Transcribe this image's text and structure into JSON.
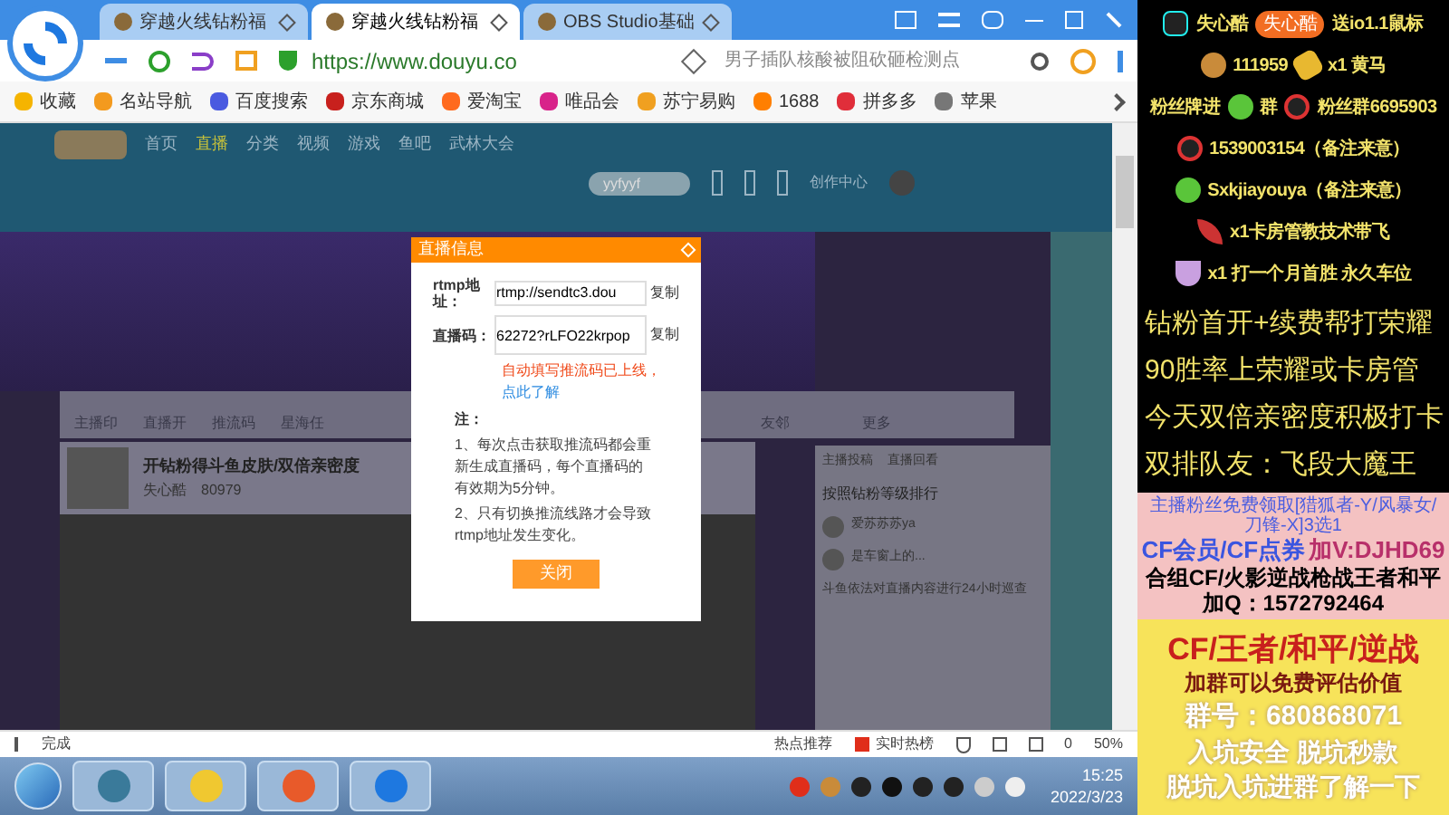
{
  "browser": {
    "tabs": [
      {
        "title": "穿越火线钻粉福",
        "selected": false
      },
      {
        "title": "穿越火线钻粉福",
        "selected": true
      },
      {
        "title": "OBS Studio基础",
        "selected": false
      }
    ],
    "url": "https://www.douyu.co",
    "search": {
      "placeholder": "男子插队核酸被阻砍砸检测点"
    },
    "bookmarks": [
      "收藏",
      "名站导航",
      "百度搜索",
      "京东商城",
      "爱淘宝",
      "唯品会",
      "苏宁易购",
      "1688",
      "拼多多",
      "苹果"
    ]
  },
  "page": {
    "nav": [
      {
        "label": "首页",
        "selected": false
      },
      {
        "label": "直播",
        "selected": true
      },
      {
        "label": "分类",
        "selected": false
      },
      {
        "label": "视频",
        "selected": false
      },
      {
        "label": "游戏",
        "selected": false
      },
      {
        "label": "鱼吧",
        "selected": false
      },
      {
        "label": "武林大会",
        "selected": false
      }
    ],
    "search": {
      "value": "yyfyyf"
    },
    "creator_link": "创作中心",
    "room_tools": [
      "主播印",
      "直播开",
      "推流码",
      "星海任",
      "友邻",
      "更多"
    ],
    "room": {
      "title": "开钻粉得斗鱼皮肤/双倍亲密度",
      "streamer": "失心酷",
      "hot": "80979"
    },
    "side": {
      "tabs": [
        "主播投稿",
        "直播回看"
      ],
      "rank_title": "按照钻粉等级排行",
      "fans": [
        "爱苏苏苏ya",
        "是车窗上的..."
      ],
      "notice": "斗鱼依法对直播内容进行24小时巡查"
    }
  },
  "dialog": {
    "title": "直播信息",
    "address_label": "rtmp地址：",
    "address": "rtmp://sendtc3.dou",
    "code_label": "直播码：",
    "code": "62272?rLFO22krpop",
    "copy": [
      "复制",
      "复制"
    ],
    "notice": "自动填写推流码已上线，",
    "link": "点此了解",
    "note_title": "注：",
    "notes": [
      "1、每次点击获取推流码都会重新生成直播码，每个直播码的有效期为5分钟。",
      "2、只有切换推流线路才会导致rtmp地址发生变化。"
    ],
    "close": "关闭"
  },
  "status_bar": {
    "text": "完成",
    "hot": "热点推荐",
    "rank": "实时热榜",
    "count": "0",
    "zoom": "50%"
  },
  "taskbar": {
    "time": "15:25",
    "date": "2022/3/23"
  },
  "overlay": {
    "rows": [
      {
        "parts": [
          {
            "kind": "icon"
          },
          {
            "kind": "text",
            "text": "失心酷"
          },
          {
            "kind": "badge",
            "text": "失心酷"
          },
          {
            "kind": "text",
            "text": "送io1.1鼠标"
          }
        ]
      },
      {
        "parts": [
          {
            "kind": "icon"
          },
          {
            "kind": "text",
            "text": "111959"
          },
          {
            "kind": "icon"
          },
          {
            "kind": "text",
            "text": "x1 黄马"
          }
        ]
      },
      {
        "parts": [
          {
            "kind": "text",
            "text": "粉丝牌进"
          },
          {
            "kind": "icon"
          },
          {
            "kind": "text",
            "text": "群"
          },
          {
            "kind": "icon"
          },
          {
            "kind": "text",
            "text": "粉丝群6695903"
          }
        ]
      },
      {
        "parts": [
          {
            "kind": "icon"
          },
          {
            "kind": "text",
            "text": "1539003154（备注来意）"
          }
        ]
      },
      {
        "parts": [
          {
            "kind": "icon"
          },
          {
            "kind": "text",
            "text": "Sxkjiayouya（备注来意）"
          }
        ]
      },
      {
        "parts": [
          {
            "kind": "icon"
          },
          {
            "kind": "text",
            "text": "x1卡房管教技术带飞"
          }
        ]
      },
      {
        "parts": [
          {
            "kind": "icon"
          },
          {
            "kind": "text",
            "text": "x1 打一个月首胜 永久车位"
          }
        ]
      }
    ],
    "big_lines": [
      "钻粉首开+续费帮打荣耀",
      "90胜率上荣耀或卡房管",
      "今天双倍亲密度积极打卡",
      "双排队友：飞段大魔王"
    ],
    "promo": {
      "note": "主播粉丝免费领取[猎狐者-Y/风暴女/刀锋-X]3选1",
      "cf": "CF会员/CF点券",
      "contact": "加V:DJHD69",
      "group_line": "合组CF/火影逆战枪战王者和平加Q：1572792464"
    },
    "ad": {
      "headline": "CF/王者/和平/逆战",
      "sub": "加群可以免费评估价值",
      "group": "群号：680868071",
      "lines": [
        "入坑安全 脱坑秒款",
        "脱坑入坑进群了解一下"
      ]
    }
  }
}
